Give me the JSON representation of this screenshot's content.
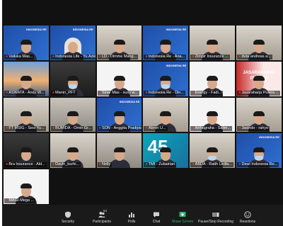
{
  "participants": [
    {
      "name": "Valluka Mas...",
      "bg": "blue",
      "logo": true
    },
    {
      "name": "Indonesia Life - Yu Azkia",
      "bg": "blue",
      "logo": true,
      "hijab": true
    },
    {
      "name": "LD - Dimme Mang...",
      "bg": "office"
    },
    {
      "name": "Indonesia Re - Ana...",
      "bg": "blue",
      "logo": true
    },
    {
      "name": "Zimpir Insurance ...",
      "bg": "office"
    },
    {
      "name": "duta andreas a...",
      "bg": "office"
    },
    {
      "name": "ASWATA - Andy W...",
      "bg": "bridge"
    },
    {
      "name": "Manin_PFT",
      "bg": "dark",
      "mask": true
    },
    {
      "name": "Sinar Mas - susy w...",
      "bg": "white"
    },
    {
      "name": "Indonesia Re - Din...",
      "bg": "blue",
      "logo": true,
      "mask": true
    },
    {
      "name": "Energy - Fadi...",
      "bg": "white"
    },
    {
      "name": "Jasaraharja Putera ...",
      "bg": "red"
    },
    {
      "name": "FT MSIG - Sesi Yu...",
      "bg": "office"
    },
    {
      "name": "BUMIDA - Omie Gr...",
      "bg": "gray"
    },
    {
      "name": "SON - Anggita Pradipta",
      "bg": "blue",
      "logo": true
    },
    {
      "name": "Abrori U...",
      "bg": "office"
    },
    {
      "name": "Arthagraha - Salim...",
      "bg": "white"
    },
    {
      "name": "Jasindo - rahyo",
      "bg": "office"
    },
    {
      "name": "Bra Insurance - Ald...",
      "bg": "dark"
    },
    {
      "name": "Davin_burhi...",
      "bg": "office"
    },
    {
      "name": "Nelly",
      "bg": "gray"
    },
    {
      "name": "TMI - Zubairian",
      "bg": "teal",
      "big": "45"
    },
    {
      "name": "ABDA - Ratih Ledta...",
      "bg": "office",
      "mask": true
    },
    {
      "name": "Dewi Indonesia Re...",
      "bg": "blue",
      "logo": true,
      "mask": true
    },
    {
      "name": "MAGI-Mega ...",
      "bg": "white"
    }
  ],
  "banners": {
    "jasaraharja": "JASARAHARJA PUTERA"
  },
  "logo_text": "INDONESIA RE",
  "toolbar": {
    "security": "Security",
    "participants": "Participants",
    "participants_count": "54",
    "polls": "Polls",
    "chat": "Chat",
    "share_screen": "Share Screen",
    "pause_recording": "Pause/Stop Recording",
    "reactions": "Reactions"
  },
  "colors": {
    "toolbar_bg": "#1a1a1a",
    "share_accent": "#2bb673",
    "mic_muted": "#e53935"
  }
}
